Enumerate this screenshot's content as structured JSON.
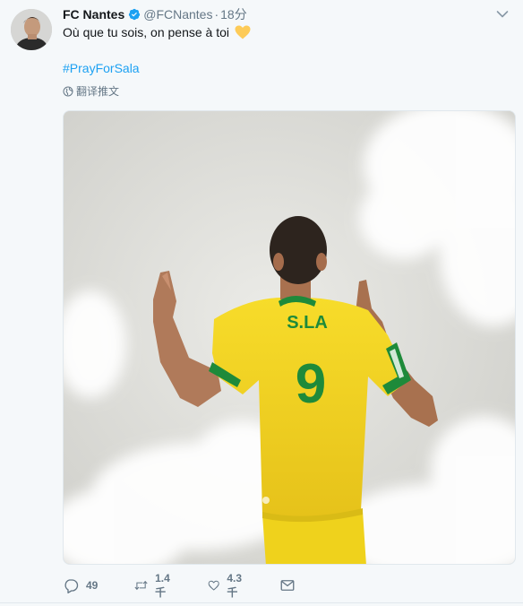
{
  "tweet": {
    "author_name": "FC Nantes",
    "handle": "@FCNantes",
    "separator": "·",
    "time": "18分",
    "text": "Où que tu sois, on pense à toi",
    "emoji": "💛",
    "hashtag": "#PrayForSala",
    "translate_label": "翻译推文",
    "jersey_name": "S.LA",
    "jersey_number": "9"
  },
  "actions": {
    "reply_count": "49",
    "retweet_count": "1.4千",
    "like_count": "4.3千"
  },
  "colors": {
    "link": "#1da1f2",
    "verified": "#1da1f2",
    "muted": "#657786",
    "jersey_yellow": "#f0d11c",
    "jersey_green": "#1e8a3a",
    "heart_emoji": "#fdcb58"
  },
  "icons": [
    "verified-badge-icon",
    "chevron-down-icon",
    "globe-icon",
    "reply-icon",
    "retweet-icon",
    "like-icon",
    "direct-message-icon"
  ]
}
